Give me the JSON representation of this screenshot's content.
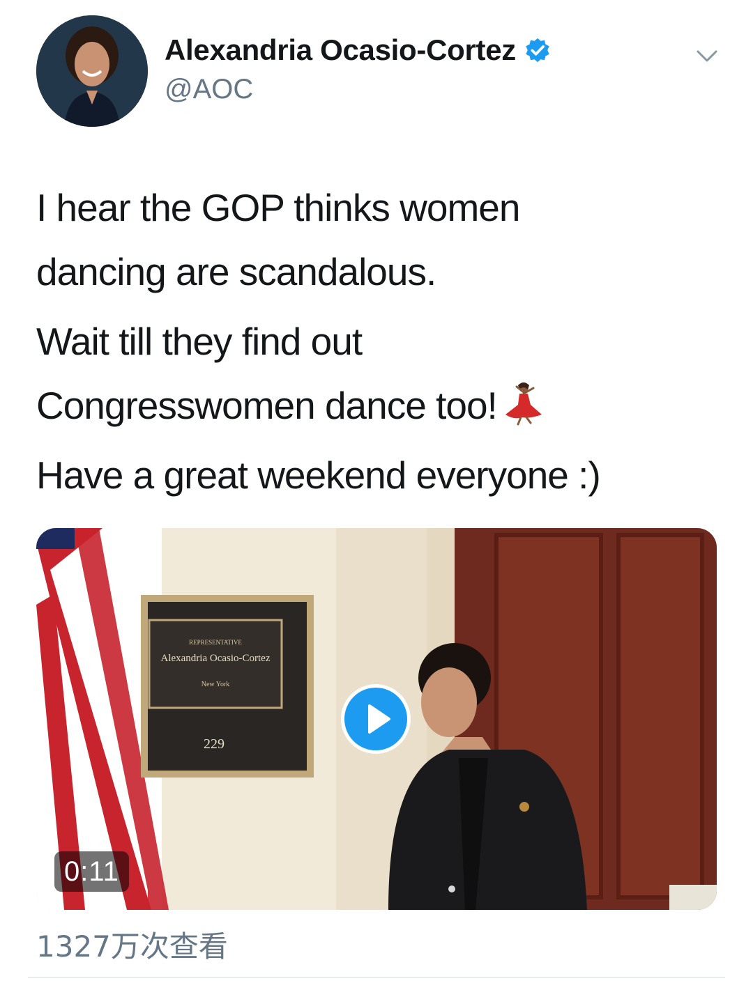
{
  "author": {
    "display_name": "Alexandria Ocasio-Cortez",
    "handle": "@AOC",
    "verified": true
  },
  "tweet": {
    "lines": [
      "I hear the GOP thinks women",
      "dancing are scandalous.",
      "Wait till they find out",
      "Congresswomen dance too!",
      "Have a great weekend everyone :)"
    ],
    "emoji": "woman-dancing-emoji"
  },
  "media": {
    "type": "video",
    "duration": "0:11",
    "plaque": {
      "title": "REPRESENTATIVE",
      "name": "Alexandria Ocasio-Cortez",
      "state": "New York",
      "room": "229"
    }
  },
  "footer": {
    "views": "1327万次查看"
  },
  "colors": {
    "accent": "#1d9bf0",
    "text": "#14171a",
    "muted": "#657786"
  }
}
